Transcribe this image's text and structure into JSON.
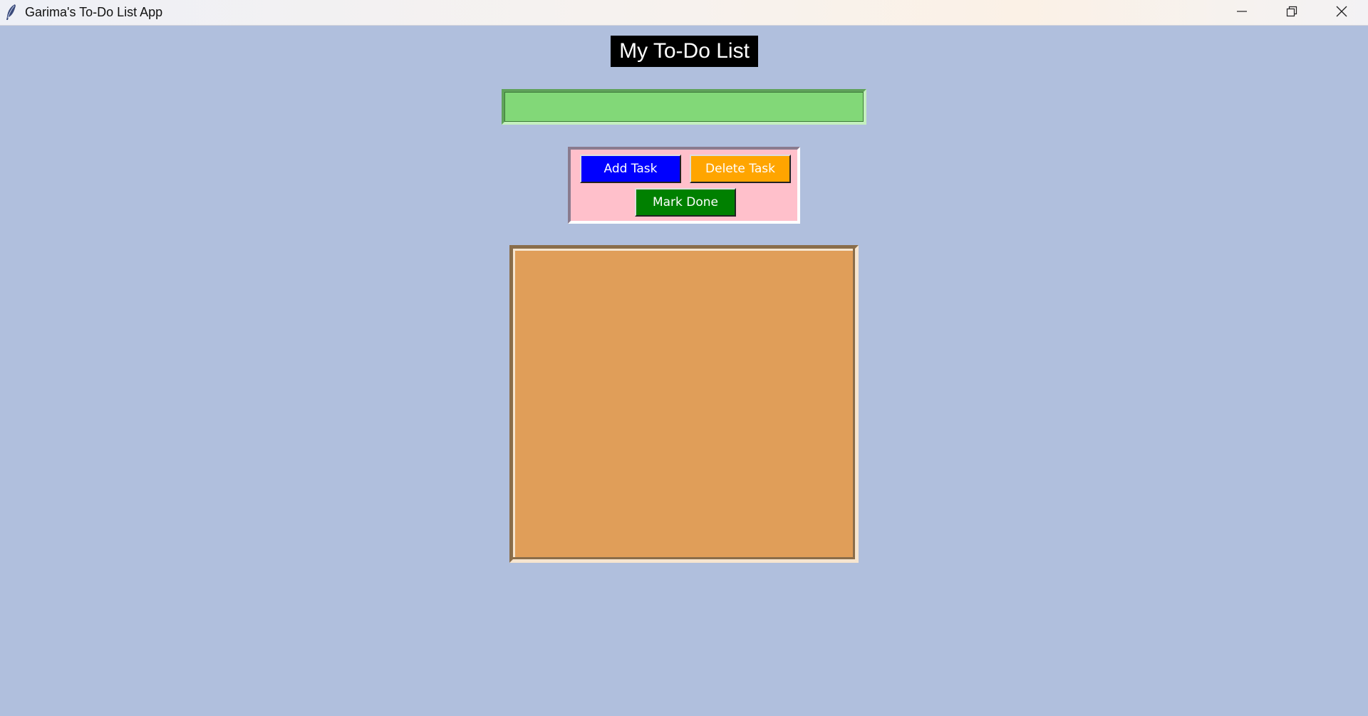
{
  "window": {
    "title": "Garima's To-Do List App",
    "app_icon": "feather-icon",
    "controls": {
      "minimize_icon": "minimize-icon",
      "restore_icon": "restore-icon",
      "close_icon": "close-icon"
    }
  },
  "heading": {
    "text": "My To-Do List"
  },
  "task_entry": {
    "value": "",
    "placeholder": ""
  },
  "buttons": {
    "add_label": "Add Task",
    "delete_label": "Delete Task",
    "mark_done_label": "Mark Done"
  },
  "task_list": {
    "items": []
  },
  "colors": {
    "background": "#b0bfdd",
    "heading_bg": "#000000",
    "entry_bg": "#82d878",
    "button_frame_bg": "#ffc0cb",
    "add_button": "#0000ff",
    "delete_button": "#ffa500",
    "mark_done_button": "#008000",
    "list_bg": "#e09e59"
  }
}
